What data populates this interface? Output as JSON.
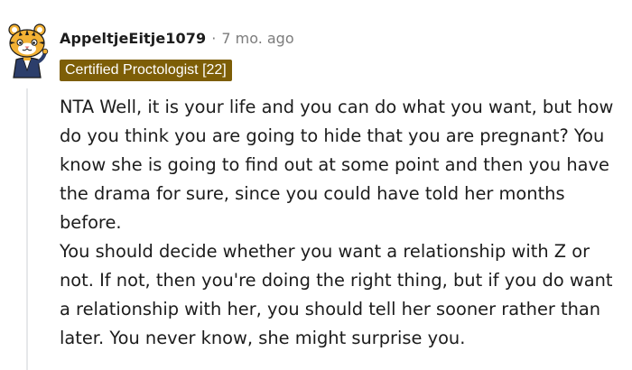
{
  "comment": {
    "username": "AppeltjeEitje1079",
    "separator": "·",
    "age": "7 mo. ago",
    "flair": "Certified Proctologist [22]",
    "avatar_icon": "tiger-snoo-avatar-icon",
    "paragraphs": [
      "NTA Well, it is your life and you can do what you want, but how do you think you are going to hide that you are pregnant? You know she is going to find out at some point and then you have the drama for sure, since you could have told her months before.",
      "You should decide whether you want a relationship with Z or not. If not, then you're doing the right thing, but if you do want a relationship with her, you should tell her sooner rather than later. You never know, she might surprise you."
    ]
  },
  "colors": {
    "flair_bg": "#7d5e07",
    "flair_text": "#ffffff",
    "meta_text": "#7c7c7c",
    "body_text": "#1c1c1c",
    "thread_line": "#e6e8ea"
  }
}
